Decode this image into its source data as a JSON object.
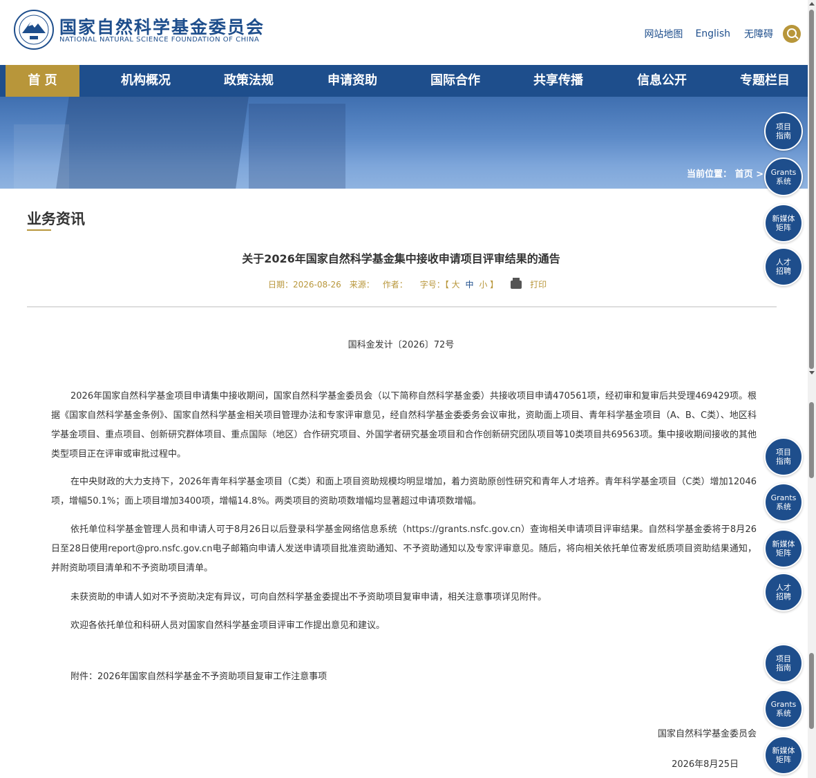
{
  "header": {
    "site_name": "国家自然科学基金委员会",
    "site_name_en": "NATIONAL NATURAL SCIENCE FOUNDATION OF CHINA",
    "links": [
      "网站地图",
      "English",
      "无障碍"
    ]
  },
  "nav": {
    "items": [
      {
        "label": "首 页",
        "active": true
      },
      {
        "label": "机构概况"
      },
      {
        "label": "政策法规"
      },
      {
        "label": "申请资助"
      },
      {
        "label": "国际合作"
      },
      {
        "label": "共享传播"
      },
      {
        "label": "信息公开"
      },
      {
        "label": "专题栏目"
      }
    ]
  },
  "breadcrumb": "当前位置：  首页 >",
  "section_title": "业务资讯",
  "article": {
    "title": "关于2026年国家自然科学基金集中接收申请项目评审结果的通告",
    "meta": {
      "date": "日期：2026-08-26",
      "source": "来源：",
      "author": "作者：",
      "fontsize_label": "字号：【",
      "font_l": "大",
      "font_m": "中",
      "font_s": "小",
      "fontsize_end": "】",
      "print": "打印"
    },
    "doc_no": "国科金发计〔2026〕72号",
    "paragraphs": [
      "2026年国家自然科学基金项目申请集中接收期间，国家自然科学基金委员会（以下简称自然科学基金委）共接收项目申请470561项，经初审和复审后共受理469429项。根据《国家自然科学基金条例》、国家自然科学基金相关项目管理办法和专家评审意见，经自然科学基金委委务会议审批，资助面上项目、青年科学基金项目（A、B、C类）、地区科学基金项目、重点项目、创新研究群体项目、重点国际（地区）合作研究项目、外国学者研究基金项目和合作创新研究团队项目等10类项目共69563项。集中接收期间接收的其他类型项目正在评审或审批过程中。",
      "在中央财政的大力支持下，2026年青年科学基金项目（C类）和面上项目资助规模均明显增加，着力资助原创性研究和青年人才培养。青年科学基金项目（C类）增加12046项，增幅50.1%；面上项目增加3400项，增幅14.8%。两类项目的资助项数增幅均显著超过申请项数增幅。",
      "依托单位科学基金管理人员和申请人可于8月26日以后登录科学基金网络信息系统（https://grants.nsfc.gov.cn）查询相关申请项目评审结果。自然科学基金委将于8月26日至28日使用report@pro.nsfc.gov.cn电子邮箱向申请人发送申请项目批准资助通知、不予资助通知以及专家评审意见。随后，将向相关依托单位寄发纸质项目资助结果通知，并附资助项目清单和不予资助项目清单。",
      "未获资助的申请人如对不予资助决定有异议，可向自然科学基金委提出不予资助项目复审申请，相关注意事项详见附件。",
      "欢迎各依托单位和科研人员对国家自然科学基金项目评审工作提出意见和建议。",
      "附件：2026年国家自然科学基金不予资助项目复审工作注意事项"
    ],
    "signature": "国家自然科学基金委员会",
    "sign_date": "2026年8月25日"
  },
  "floats": [
    {
      "l1": "项目",
      "l2": "指南"
    },
    {
      "l1": "Grants",
      "l2": "系统"
    },
    {
      "l1": "新媒体",
      "l2": "矩阵"
    },
    {
      "l1": "人才",
      "l2": "招聘"
    },
    {
      "l1": "项目",
      "l2": "指南"
    },
    {
      "l1": "Grants",
      "l2": "系统"
    },
    {
      "l1": "新媒体",
      "l2": "矩阵"
    },
    {
      "l1": "人才",
      "l2": "招聘"
    },
    {
      "l1": "项目",
      "l2": "指南"
    },
    {
      "l1": "Grants",
      "l2": "系统"
    },
    {
      "l1": "新媒体",
      "l2": "矩阵"
    }
  ],
  "colors": {
    "primary": "#1e4e8c",
    "accent": "#b8963a"
  }
}
